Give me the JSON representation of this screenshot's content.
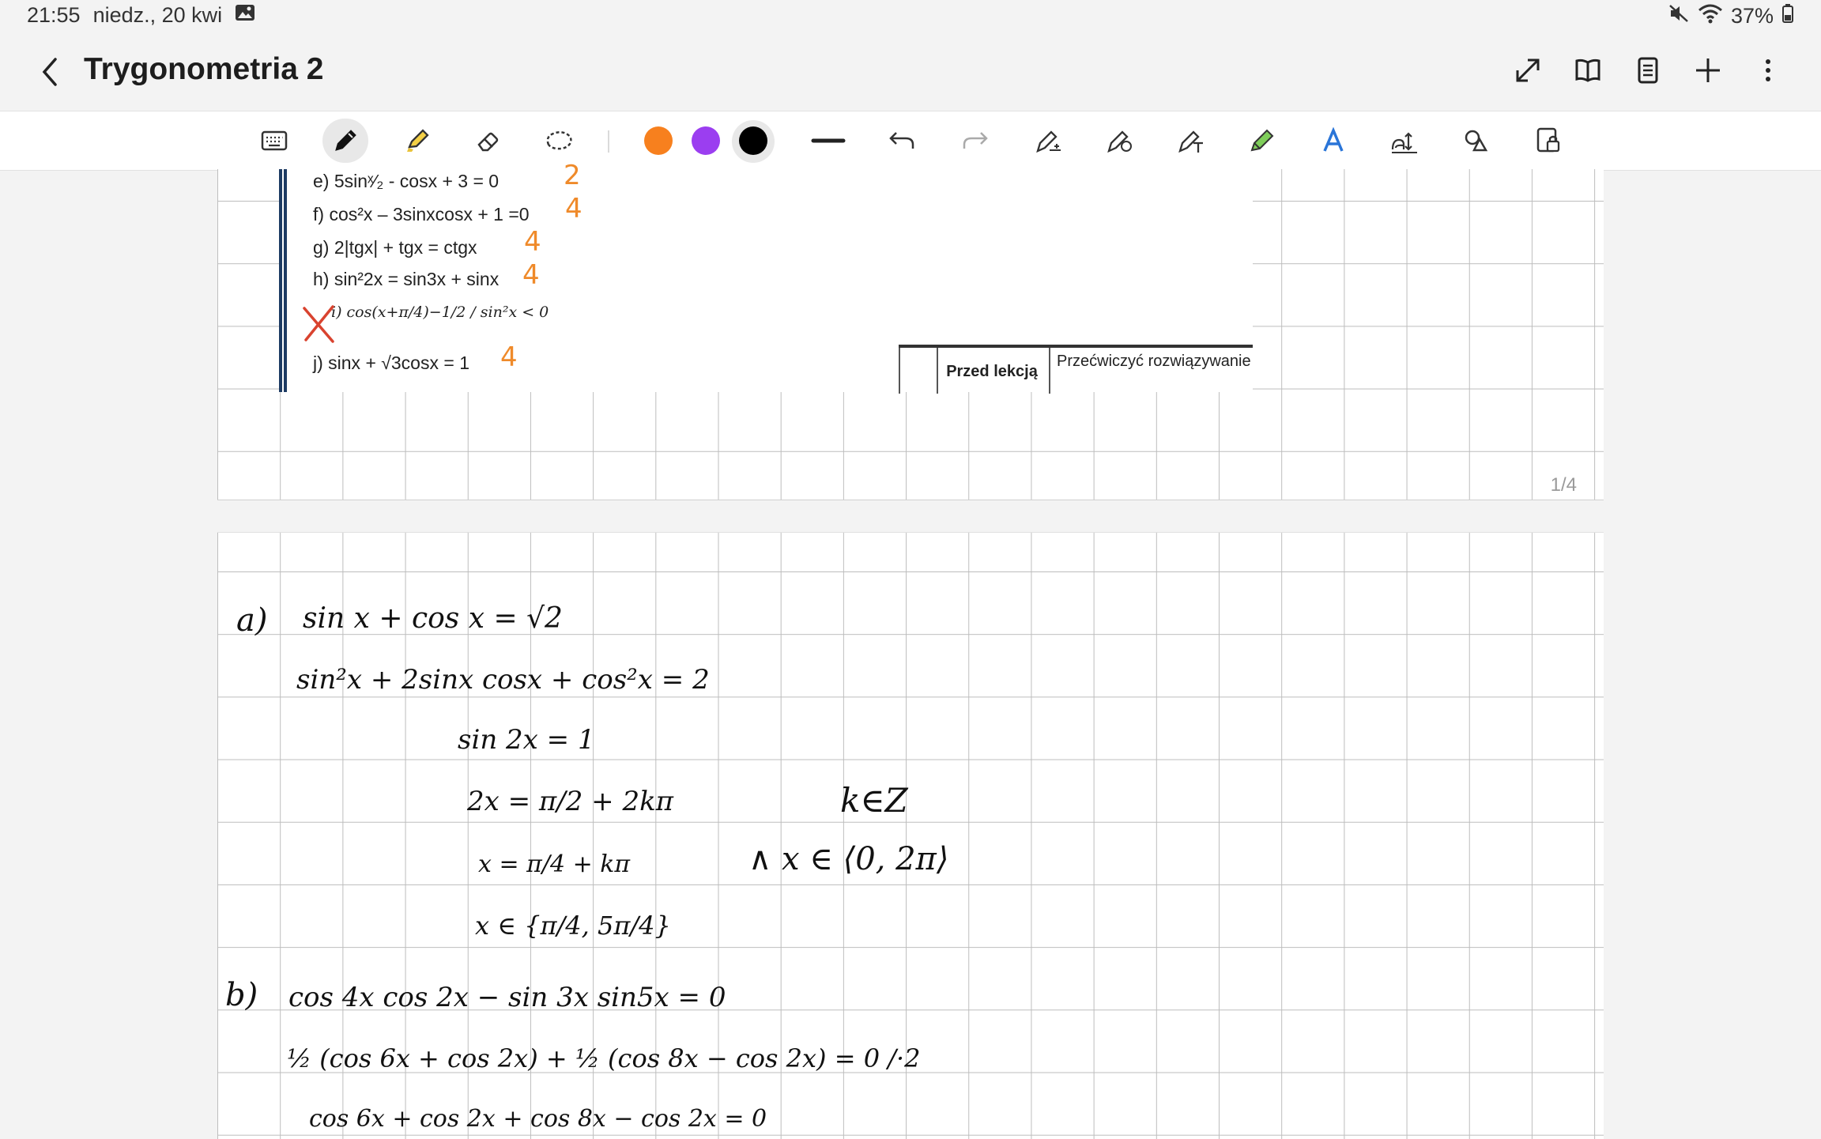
{
  "status": {
    "time": "21:55",
    "date": "niedz., 20 kwi",
    "battery": "37%"
  },
  "header": {
    "title": "Trygonometria 2"
  },
  "toolbar": {
    "colors": [
      "#f7801e",
      "#9b3ef0",
      "#000000"
    ]
  },
  "page1": {
    "tasks": [
      {
        "text": "e) 5sinˣ⁄₂ - cosx  + 3 = 0",
        "score": "2"
      },
      {
        "text": "f) cos²x – 3sinxcosx + 1 =0",
        "score": "4"
      },
      {
        "text": "g) 2|tgx| + tgx = ctgx",
        "score": "4"
      },
      {
        "text": "h) sin²2x = sin3x + sinx",
        "score": "4"
      },
      {
        "text": "i) cos(x+π/4)−1/2 / sin²x < 0",
        "score": ""
      },
      {
        "text": "j) sinx + √3cosx = 1",
        "score": "4"
      }
    ],
    "plan": {
      "col_before": "Przed lekcją",
      "col_practice": "Przećwiczyć rozwiązywanie"
    },
    "page_number": "1/4"
  },
  "notes": {
    "a_label": "a)",
    "a1": "sin x  + cos x = √2",
    "a2": "sin²x + 2sinx cosx + cos²x = 2",
    "a3": "sin 2x = 1",
    "a4": "2x = π/2 + 2kπ",
    "a4b": "k∈Z",
    "a5": "x = π/4 + kπ",
    "a5b": "∧   x ∈ ⟨0, 2π⟩",
    "a6": "x ∈ {π/4, 5π/4}",
    "b_label": "b)",
    "b1": "cos 4x cos 2x −  sin 3x  sin5x = 0",
    "b2": "½ (cos 6x + cos 2x) + ½ (cos 8x − cos 2x) = 0 /·2",
    "b3": "cos 6x + cos 2x + cos 8x − cos 2x = 0"
  }
}
